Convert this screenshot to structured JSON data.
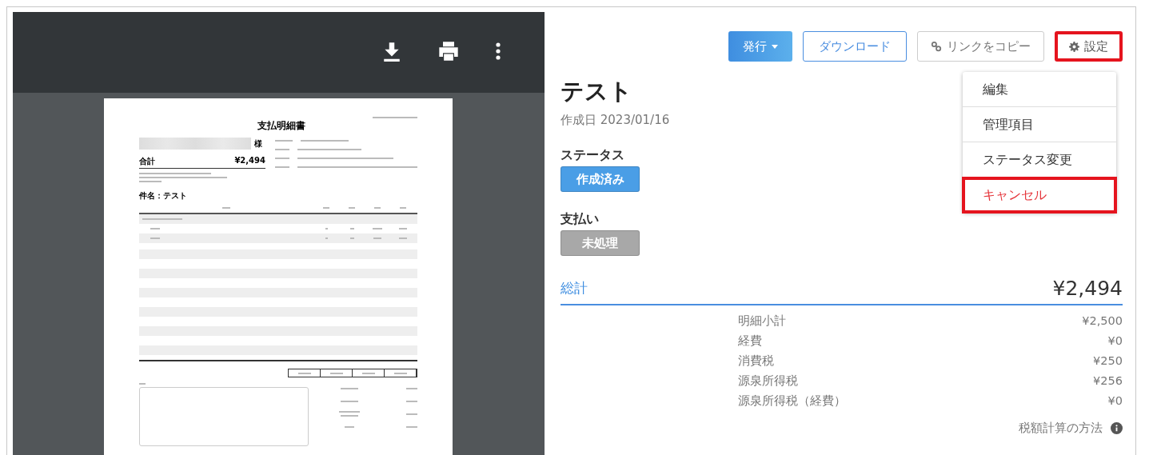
{
  "preview": {
    "document": {
      "title": "支払明細書",
      "honorific": "様",
      "total_label": "合計",
      "total_value": "¥2,494",
      "subject": "件名：テスト"
    }
  },
  "actions": [
    {
      "label": "発行",
      "kind": "primary",
      "highlighted": false
    },
    {
      "label": "ダウンロード",
      "kind": "outline",
      "highlighted": false
    },
    {
      "label": "リンクをコピー",
      "kind": "link",
      "highlighted": false
    },
    {
      "label": "設定",
      "kind": "settings",
      "highlighted": true
    }
  ],
  "menu": [
    {
      "label": "編集",
      "highlighted": false,
      "danger": false
    },
    {
      "label": "管理項目",
      "highlighted": false,
      "danger": false
    },
    {
      "label": "ステータス変更",
      "highlighted": false,
      "danger": false
    },
    {
      "label": "キャンセル",
      "highlighted": true,
      "danger": true
    }
  ],
  "title": "テスト",
  "created": "作成日 2023/01/16",
  "statuses": [
    {
      "label": "ステータス",
      "badge": "作成済み",
      "color": "#4a9ee6"
    },
    {
      "label": "支払い",
      "badge": "未処理",
      "color": "#a8a8a8"
    }
  ],
  "total": {
    "label": "総計",
    "value": "¥2,494"
  },
  "breakdown": [
    {
      "label": "明細小計",
      "value": "¥2,500"
    },
    {
      "label": "経費",
      "value": "¥0"
    },
    {
      "label": "消費税",
      "value": "¥250"
    },
    {
      "label": "源泉所得税",
      "value": "¥256"
    },
    {
      "label": "源泉所得税（経費）",
      "value": "¥0"
    }
  ],
  "tax_method": "税額計算の方法"
}
